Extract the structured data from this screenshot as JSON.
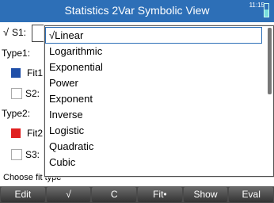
{
  "header": {
    "title": "Statistics 2Var Symbolic View",
    "clock": "11:15"
  },
  "rows": {
    "s1_label": "S1:",
    "s1_check": "√",
    "type1_label": "Type1:",
    "fit1_label": "Fit1",
    "s2_label": "S2:",
    "type2_label": "Type2:",
    "fit2_label": "Fit2",
    "s3_label": "S3:"
  },
  "colors": {
    "accent": "#2d6fb7",
    "fit1": "#1f4fa8",
    "fit2": "#e02020"
  },
  "dropdown": {
    "options": [
      {
        "label": "Linear",
        "mark": "√"
      },
      {
        "label": "Logarithmic"
      },
      {
        "label": "Exponential"
      },
      {
        "label": "Power"
      },
      {
        "label": "Exponent"
      },
      {
        "label": "Inverse"
      },
      {
        "label": "Logistic"
      },
      {
        "label": "Quadratic"
      },
      {
        "label": "Cubic"
      }
    ]
  },
  "hint": "Choose fit type",
  "softkeys": [
    "Edit",
    "√",
    "C",
    "Fit•",
    "Show",
    "Eval"
  ]
}
